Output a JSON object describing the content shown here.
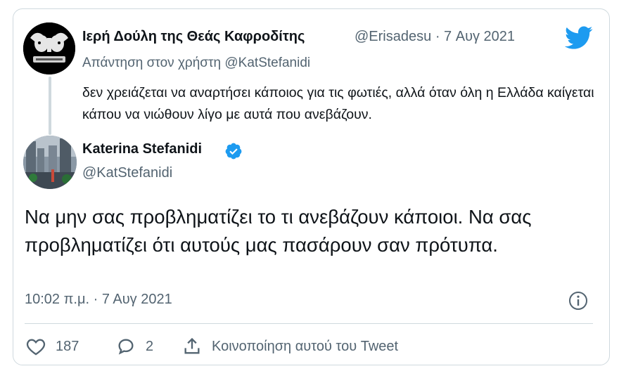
{
  "parent": {
    "display_name": "Ιερή Δούλη της Θεάς Καφροδίτης",
    "handle": "@Erisadesu",
    "separator": "·",
    "date": "7 Αυγ 2021",
    "reply_prefix": "Απάντηση στον χρήστη",
    "reply_to": "@KatStefanidi",
    "text": "δεν χρειάζεται να αναρτήσει κάποιος για τις φωτιές, αλλά όταν όλη η Ελλάδα καίγεται κάπου να νιώθουν λίγο με αυτά που ανεβάζουν."
  },
  "main": {
    "display_name": "Katerina Stefanidi",
    "handle": "@KatStefanidi",
    "verified_icon": "verified-badge-icon",
    "text": "Να μην σας προβληματίζει το τι ανεβάζουν κάποιοι. Να σας προβληματίζει ότι αυτούς μας πασάρουν σαν πρότυπα.",
    "timestamp": "10:02 π.μ. · 7 Αυγ 2021"
  },
  "actions": {
    "likes": "187",
    "replies": "2",
    "share_label": "Κοινοποίηση αυτού του Tweet"
  },
  "colors": {
    "twitter_blue": "#1d9bf0",
    "text_primary": "#0f1419",
    "text_secondary": "#536471",
    "border": "#cfd9de"
  }
}
